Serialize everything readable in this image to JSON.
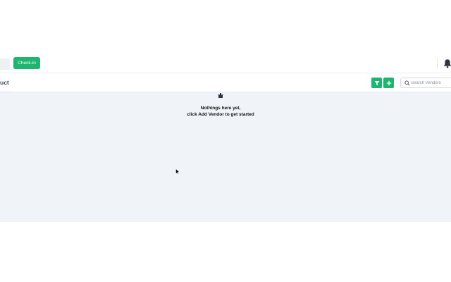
{
  "topbar": {
    "checkin_label": "Check-in",
    "bell_icon": "bell-icon"
  },
  "header": {
    "title": "uct",
    "filter_icon": "filter-icon",
    "add_icon": "plus-icon",
    "search_placeholder": "Search Vendors"
  },
  "empty_state": {
    "icon": "box-icon",
    "line1": "Nothings here yet,",
    "line2": "click Add Vendor to get started"
  },
  "colors": {
    "accent": "#1db56f",
    "content_bg": "#f0f3f8"
  }
}
